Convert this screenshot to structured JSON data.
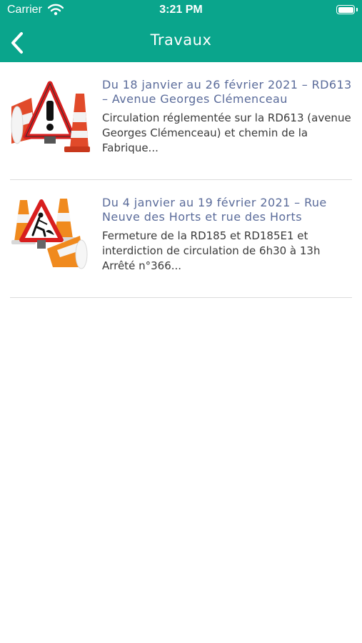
{
  "status_bar": {
    "carrier": "Carrier",
    "time": "3:21 PM"
  },
  "nav": {
    "title": "Travaux"
  },
  "items": [
    {
      "heading": "Du 18 janvier au 26 février 2021 – RD613 – Avenue Georges Clémenceau",
      "description": "Circulation réglementée sur la RD613 (avenue Georges Clémenceau) et chemin de la Fabrique..."
    },
    {
      "heading": "Du 4 janvier au 19 février 2021 – Rue Neuve des Horts et rue des Horts",
      "description": "Fermeture de la RD185 et RD185E1 et interdiction de circulation de 6h30 à 13h Arrêté n°366..."
    }
  ],
  "colors": {
    "header": "#0aa58c",
    "heading_text": "#5a6b9a",
    "body_text": "#3a3a3a"
  },
  "icons": [
    "wifi-icon",
    "battery-icon",
    "back-chevron-icon",
    "warning-sign-cones-icon",
    "roadworks-sign-cones-icon"
  ]
}
